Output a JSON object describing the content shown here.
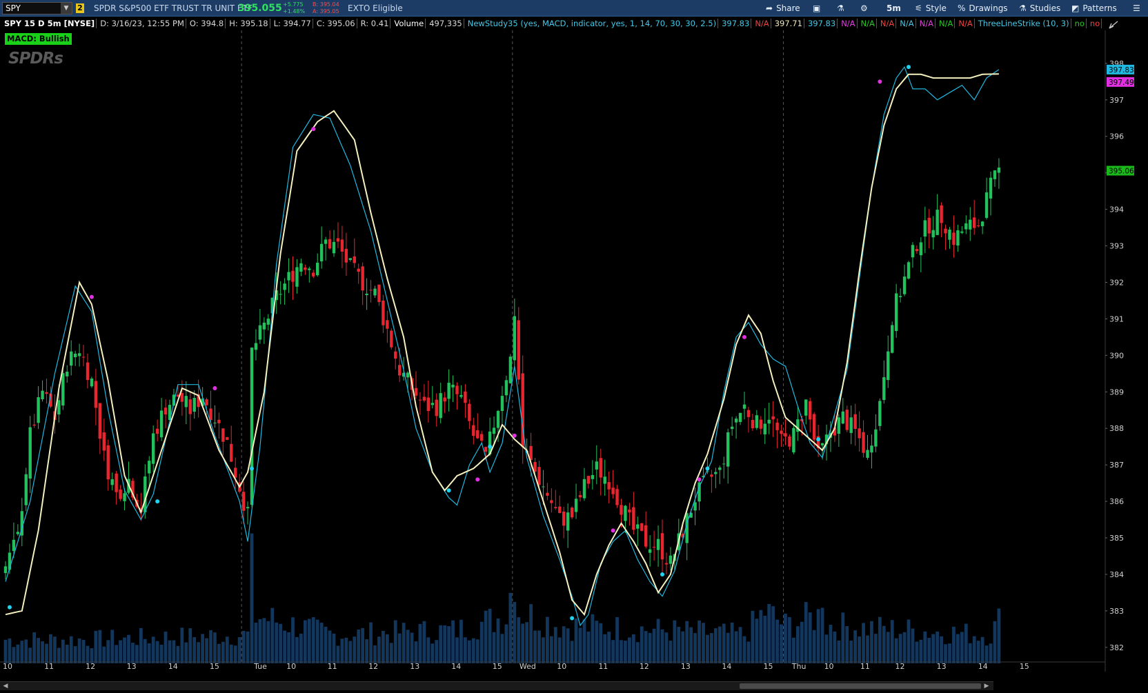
{
  "toolbar": {
    "symbol": "SPY",
    "link_group": "2",
    "description": "SPDR S&P500 ETF TRUST TR UNIT ETF",
    "last_price": "395.055",
    "net_change": "+5.775",
    "percent_change": "+1.48%",
    "bid": "B: 395.04",
    "ask": "A: 395.05",
    "exto": "EXTO Eligible",
    "share_label": "Share",
    "timeframe": "5m",
    "style_label": "Style",
    "drawings_label": "Drawings",
    "studies_label": "Studies",
    "patterns_label": "Patterns"
  },
  "infobar": {
    "chart_title": "SPY 15 D 5m [NYSE]",
    "date": "D: 3/16/23, 12:55 PM",
    "open": "O: 394.8",
    "high": "H: 395.18",
    "low": "L: 394.77",
    "close": "C: 395.06",
    "range": "R: 0.41",
    "volume_label": "Volume",
    "volume_value": "497,335",
    "study_name": "NewStudy35 (yes, MACD, indicator, yes, 1, 14, 70, 30, 30, 2.5)",
    "study_values": [
      "397.83",
      "N/A",
      "397.71",
      "397.83",
      "N/A",
      "N/A",
      "N/A",
      "N/A",
      "N/A",
      "N/A",
      "N/A"
    ],
    "study_colors": [
      "#44c8e8",
      "#f04040",
      "#f2e8b8",
      "#44c8e8",
      "#e040e0",
      "#22c822",
      "#f04040",
      "#44c8e8",
      "#e040e0",
      "#22c822",
      "#f04040"
    ],
    "tls_name": "ThreeLineStrike (10, 3)",
    "tls_values": [
      "no",
      "no"
    ],
    "tls_colors": [
      "#22c822",
      "#f04040"
    ]
  },
  "macd_status": "MACD: Bullish",
  "watermark": "SPDRs",
  "colors": {
    "up": "#22c15e",
    "down": "#e8262f",
    "volume": "#12365c",
    "fast_line": "#1fb8e0",
    "slow_line": "#f5f0c0",
    "marker_buy": "#1ed4f0",
    "marker_sell": "#e030e0",
    "price_tag": "#1ab81a"
  },
  "chart_data": {
    "type": "candlestick",
    "y_axis": {
      "min": 381.6,
      "max": 398.3,
      "ticks": [
        382,
        383,
        384,
        385,
        386,
        387,
        388,
        389,
        390,
        391,
        392,
        393,
        394,
        395,
        396,
        397,
        398
      ]
    },
    "x_axis": {
      "labels": [
        "10",
        "11",
        "12",
        "13",
        "14",
        "15",
        "Tue",
        "10",
        "11",
        "12",
        "13",
        "14",
        "15",
        "Wed",
        "10",
        "11",
        "12",
        "13",
        "14",
        "15",
        "Thu",
        "10",
        "11",
        "12",
        "13",
        "14",
        "15"
      ],
      "day_separators": [
        "Tue",
        "Wed",
        "Thu"
      ]
    },
    "price_anchors": [
      [
        0,
        384.2
      ],
      [
        3,
        385.0
      ],
      [
        6,
        387.8
      ],
      [
        9,
        389.0
      ],
      [
        12,
        388.3
      ],
      [
        15,
        389.8
      ],
      [
        18,
        390.2
      ],
      [
        21,
        389.3
      ],
      [
        24,
        387.2
      ],
      [
        27,
        386.2
      ],
      [
        30,
        386.6
      ],
      [
        33,
        385.8
      ],
      [
        36,
        387.8
      ],
      [
        39,
        388.6
      ],
      [
        42,
        388.9
      ],
      [
        45,
        388.5
      ],
      [
        48,
        388.9
      ],
      [
        51,
        388.3
      ],
      [
        54,
        387.6
      ],
      [
        57,
        386.4
      ],
      [
        59,
        385.6
      ],
      [
        60,
        390.1
      ],
      [
        63,
        390.8
      ],
      [
        66,
        391.6
      ],
      [
        69,
        392.1
      ],
      [
        72,
        392.6
      ],
      [
        75,
        392.4
      ],
      [
        78,
        393.1
      ],
      [
        81,
        393.0
      ],
      [
        84,
        392.4
      ],
      [
        87,
        392.0
      ],
      [
        90,
        391.7
      ],
      [
        93,
        390.7
      ],
      [
        96,
        389.6
      ],
      [
        99,
        389.1
      ],
      [
        102,
        388.6
      ],
      [
        105,
        388.6
      ],
      [
        108,
        389.1
      ],
      [
        111,
        388.8
      ],
      [
        114,
        387.8
      ],
      [
        117,
        387.2
      ],
      [
        120,
        388.6
      ],
      [
        123,
        389.9
      ],
      [
        124,
        391.2
      ],
      [
        126,
        387.5
      ],
      [
        129,
        386.8
      ],
      [
        132,
        386.2
      ],
      [
        135,
        385.5
      ],
      [
        138,
        385.6
      ],
      [
        141,
        386.4
      ],
      [
        144,
        386.9
      ],
      [
        147,
        386.6
      ],
      [
        150,
        385.9
      ],
      [
        153,
        385.2
      ],
      [
        156,
        384.9
      ],
      [
        159,
        384.8
      ],
      [
        162,
        384.3
      ],
      [
        165,
        385.2
      ],
      [
        168,
        386.1
      ],
      [
        171,
        386.6
      ],
      [
        174,
        386.8
      ],
      [
        177,
        388.1
      ],
      [
        180,
        388.6
      ],
      [
        183,
        388.1
      ],
      [
        186,
        388.4
      ],
      [
        189,
        387.6
      ],
      [
        192,
        387.8
      ],
      [
        195,
        388.7
      ],
      [
        198,
        387.2
      ],
      [
        201,
        387.9
      ],
      [
        204,
        388.3
      ],
      [
        207,
        387.9
      ],
      [
        210,
        387.3
      ],
      [
        213,
        388.7
      ],
      [
        216,
        391.1
      ],
      [
        219,
        392.1
      ],
      [
        222,
        393.1
      ],
      [
        225,
        393.6
      ],
      [
        228,
        393.8
      ],
      [
        231,
        393.2
      ],
      [
        234,
        393.5
      ],
      [
        237,
        393.6
      ],
      [
        240,
        394.6
      ],
      [
        242,
        395.06
      ]
    ],
    "volume_anchors": [
      [
        0,
        0.25
      ],
      [
        20,
        0.25
      ],
      [
        59,
        0.3
      ],
      [
        60,
        1.0
      ],
      [
        61,
        0.5
      ],
      [
        80,
        0.3
      ],
      [
        110,
        0.35
      ],
      [
        122,
        0.5
      ],
      [
        124,
        1.0
      ],
      [
        125,
        0.55
      ],
      [
        135,
        0.4
      ],
      [
        160,
        0.35
      ],
      [
        180,
        0.3
      ],
      [
        185,
        0.55
      ],
      [
        190,
        0.4
      ],
      [
        198,
        0.5
      ],
      [
        199,
        0.8
      ],
      [
        200,
        0.4
      ],
      [
        220,
        0.35
      ],
      [
        240,
        0.3
      ],
      [
        242,
        0.45
      ]
    ],
    "fast_line_anchors": [
      [
        0,
        383.8
      ],
      [
        6,
        386.0
      ],
      [
        12,
        389.5
      ],
      [
        17,
        391.9
      ],
      [
        21,
        391.2
      ],
      [
        25,
        388.5
      ],
      [
        29,
        386.3
      ],
      [
        33,
        385.5
      ],
      [
        36,
        386.2
      ],
      [
        42,
        389.2
      ],
      [
        47,
        389.2
      ],
      [
        51,
        387.8
      ],
      [
        57,
        386.0
      ],
      [
        59,
        384.9
      ],
      [
        62,
        387.5
      ],
      [
        66,
        392.5
      ],
      [
        70,
        395.7
      ],
      [
        75,
        396.6
      ],
      [
        79,
        396.5
      ],
      [
        84,
        395.2
      ],
      [
        89,
        393.4
      ],
      [
        93,
        391.5
      ],
      [
        97,
        389.6
      ],
      [
        100,
        388.0
      ],
      [
        104,
        386.8
      ],
      [
        108,
        386.1
      ],
      [
        110,
        385.9
      ],
      [
        113,
        387.0
      ],
      [
        116,
        387.6
      ],
      [
        118,
        386.8
      ],
      [
        121,
        387.6
      ],
      [
        124,
        389.7
      ],
      [
        127,
        387.2
      ],
      [
        131,
        385.6
      ],
      [
        135,
        384.4
      ],
      [
        138,
        383.4
      ],
      [
        140,
        382.6
      ],
      [
        142,
        382.9
      ],
      [
        145,
        384.3
      ],
      [
        148,
        384.9
      ],
      [
        151,
        385.2
      ],
      [
        154,
        384.4
      ],
      [
        157,
        383.8
      ],
      [
        160,
        383.4
      ],
      [
        163,
        384.1
      ],
      [
        166,
        385.4
      ],
      [
        169,
        386.4
      ],
      [
        172,
        387.1
      ],
      [
        175,
        389.0
      ],
      [
        178,
        390.5
      ],
      [
        181,
        390.9
      ],
      [
        184,
        390.3
      ],
      [
        187,
        389.9
      ],
      [
        190,
        389.7
      ],
      [
        193,
        388.6
      ],
      [
        196,
        387.6
      ],
      [
        199,
        387.2
      ],
      [
        202,
        388.4
      ],
      [
        205,
        389.6
      ],
      [
        208,
        392.1
      ],
      [
        211,
        394.6
      ],
      [
        214,
        396.6
      ],
      [
        217,
        397.6
      ],
      [
        219,
        397.9
      ],
      [
        221,
        397.3
      ],
      [
        224,
        397.3
      ],
      [
        227,
        397.0
      ],
      [
        230,
        397.2
      ],
      [
        233,
        397.4
      ],
      [
        236,
        397.0
      ],
      [
        239,
        397.6
      ],
      [
        242,
        397.83
      ]
    ],
    "slow_line_anchors": [
      [
        0,
        382.9
      ],
      [
        4,
        383.0
      ],
      [
        8,
        385.2
      ],
      [
        13,
        389.1
      ],
      [
        18,
        392.0
      ],
      [
        21,
        391.4
      ],
      [
        25,
        389.3
      ],
      [
        29,
        386.7
      ],
      [
        33,
        385.7
      ],
      [
        38,
        387.4
      ],
      [
        43,
        389.1
      ],
      [
        47,
        388.9
      ],
      [
        52,
        387.4
      ],
      [
        57,
        386.4
      ],
      [
        59,
        386.8
      ],
      [
        63,
        389.0
      ],
      [
        67,
        392.8
      ],
      [
        71,
        395.6
      ],
      [
        76,
        396.4
      ],
      [
        80,
        396.7
      ],
      [
        85,
        395.9
      ],
      [
        89,
        393.9
      ],
      [
        93,
        392.1
      ],
      [
        97,
        390.5
      ],
      [
        100,
        388.6
      ],
      [
        104,
        386.8
      ],
      [
        107,
        386.3
      ],
      [
        110,
        386.7
      ],
      [
        114,
        386.9
      ],
      [
        118,
        387.3
      ],
      [
        121,
        388.1
      ],
      [
        124,
        387.7
      ],
      [
        127,
        387.4
      ],
      [
        131,
        386.0
      ],
      [
        135,
        384.6
      ],
      [
        138,
        383.3
      ],
      [
        141,
        382.9
      ],
      [
        144,
        384.0
      ],
      [
        147,
        384.8
      ],
      [
        150,
        385.4
      ],
      [
        153,
        384.9
      ],
      [
        156,
        384.3
      ],
      [
        159,
        383.5
      ],
      [
        162,
        384.0
      ],
      [
        165,
        385.4
      ],
      [
        168,
        386.5
      ],
      [
        171,
        387.3
      ],
      [
        175,
        388.8
      ],
      [
        178,
        390.3
      ],
      [
        181,
        391.1
      ],
      [
        184,
        390.6
      ],
      [
        187,
        389.3
      ],
      [
        190,
        388.3
      ],
      [
        193,
        388.0
      ],
      [
        196,
        387.7
      ],
      [
        199,
        387.4
      ],
      [
        202,
        388.0
      ],
      [
        205,
        389.8
      ],
      [
        208,
        392.3
      ],
      [
        211,
        394.6
      ],
      [
        214,
        396.3
      ],
      [
        217,
        397.3
      ],
      [
        220,
        397.7
      ],
      [
        223,
        397.7
      ],
      [
        226,
        397.6
      ],
      [
        229,
        397.6
      ],
      [
        232,
        397.6
      ],
      [
        235,
        397.6
      ],
      [
        238,
        397.7
      ],
      [
        242,
        397.71
      ]
    ],
    "markers": [
      {
        "bar": 1,
        "price": 383.1,
        "type": "buy"
      },
      {
        "bar": 21,
        "price": 391.6,
        "type": "sell"
      },
      {
        "bar": 37,
        "price": 386.0,
        "type": "buy"
      },
      {
        "bar": 51,
        "price": 389.1,
        "type": "sell"
      },
      {
        "bar": 60,
        "price": 386.9,
        "type": "buy"
      },
      {
        "bar": 75,
        "price": 396.2,
        "type": "sell"
      },
      {
        "bar": 108,
        "price": 386.3,
        "type": "buy"
      },
      {
        "bar": 115,
        "price": 386.6,
        "type": "sell"
      },
      {
        "bar": 118,
        "price": 387.5,
        "type": "buy"
      },
      {
        "bar": 124,
        "price": 387.8,
        "type": "sell"
      },
      {
        "bar": 138,
        "price": 382.8,
        "type": "buy"
      },
      {
        "bar": 148,
        "price": 385.2,
        "type": "sell"
      },
      {
        "bar": 160,
        "price": 384.0,
        "type": "buy"
      },
      {
        "bar": 169,
        "price": 386.6,
        "type": "sell"
      },
      {
        "bar": 171,
        "price": 386.9,
        "type": "buy"
      },
      {
        "bar": 180,
        "price": 390.5,
        "type": "sell"
      },
      {
        "bar": 198,
        "price": 387.7,
        "type": "buy"
      },
      {
        "bar": 213,
        "price": 397.5,
        "type": "sell"
      },
      {
        "bar": 220,
        "price": 397.9,
        "type": "buy"
      }
    ],
    "price_tags": [
      {
        "value": "397.83",
        "price": 397.83,
        "color": "#1fb8e0"
      },
      {
        "value": "397.49",
        "price": 397.49,
        "color": "#e030e0"
      },
      {
        "value": "395.06",
        "price": 395.06,
        "color": "#1ab81a"
      }
    ]
  }
}
